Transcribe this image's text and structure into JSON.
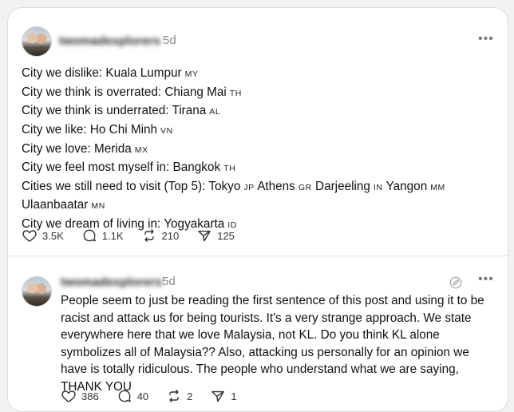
{
  "post": {
    "author_handle": "twomadexplorers",
    "time": "5d",
    "more_label": "•••",
    "lines": [
      {
        "text": "City we dislike: Kuala Lumpur",
        "codes": [
          "MY"
        ]
      },
      {
        "text": "City we think is overrated: Chiang Mai",
        "codes": [
          "TH"
        ]
      },
      {
        "text": "City we think is underrated: Tirana",
        "codes": [
          "AL"
        ]
      },
      {
        "text": "City we like: Ho Chi Minh",
        "codes": [
          "VN"
        ]
      },
      {
        "text": "City we love: Merida",
        "codes": [
          "MX"
        ]
      },
      {
        "text": "City we feel most myself in: Bangkok",
        "codes": [
          "TH"
        ]
      },
      {
        "text": "Cities we still need to visit (Top 5): Tokyo",
        "codes": [
          "JP"
        ]
      },
      {
        "text": "Ulaanbaatar",
        "codes": [
          "MN"
        ]
      },
      {
        "text": "City we dream of living in: Yogyakarta",
        "codes": [
          "ID"
        ]
      }
    ],
    "line7_rest": [
      {
        "name": "Athens",
        "code": "GR"
      },
      {
        "name": "Darjeeling",
        "code": "IN"
      },
      {
        "name": "Yangon",
        "code": "MM"
      }
    ],
    "actions": {
      "likes": "3.5K",
      "replies": "1.1K",
      "reposts": "210",
      "shares": "125"
    }
  },
  "reply": {
    "author_handle": "twomadexplorers",
    "time": "5d",
    "text": "People seem to just be reading the first sentence of this post and using it to be racist and attack us for being tourists. It's a very strange approach. We state everywhere here that we love Malaysia, not KL. Do you think KL alone symbolizes all of Malaysia?? Also, attacking us personally for an opinion we have is totally ridiculous. The people who understand what we are saying, THANK YOU",
    "actions": {
      "likes": "386",
      "replies": "40",
      "reposts": "2",
      "shares": "1"
    }
  },
  "icons": {
    "heart": "heart-icon",
    "reply": "reply-icon",
    "repost": "repost-icon",
    "share": "share-icon",
    "more": "more-icon",
    "edit": "edit-icon"
  }
}
